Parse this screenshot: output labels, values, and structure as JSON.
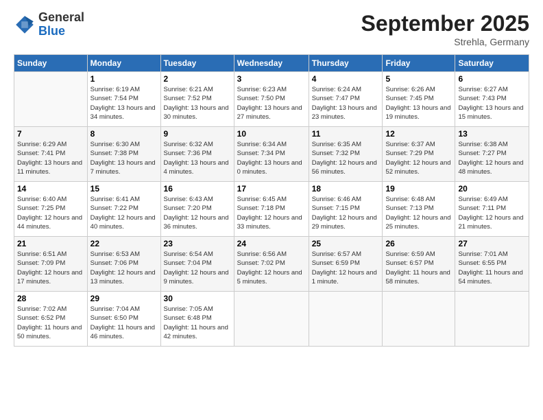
{
  "logo": {
    "general": "General",
    "blue": "Blue"
  },
  "header": {
    "month": "September 2025",
    "location": "Strehla, Germany"
  },
  "days": [
    "Sunday",
    "Monday",
    "Tuesday",
    "Wednesday",
    "Thursday",
    "Friday",
    "Saturday"
  ],
  "weeks": [
    [
      {
        "date": "",
        "sunrise": "",
        "sunset": "",
        "daylight": ""
      },
      {
        "date": "1",
        "sunrise": "Sunrise: 6:19 AM",
        "sunset": "Sunset: 7:54 PM",
        "daylight": "Daylight: 13 hours and 34 minutes."
      },
      {
        "date": "2",
        "sunrise": "Sunrise: 6:21 AM",
        "sunset": "Sunset: 7:52 PM",
        "daylight": "Daylight: 13 hours and 30 minutes."
      },
      {
        "date": "3",
        "sunrise": "Sunrise: 6:23 AM",
        "sunset": "Sunset: 7:50 PM",
        "daylight": "Daylight: 13 hours and 27 minutes."
      },
      {
        "date": "4",
        "sunrise": "Sunrise: 6:24 AM",
        "sunset": "Sunset: 7:47 PM",
        "daylight": "Daylight: 13 hours and 23 minutes."
      },
      {
        "date": "5",
        "sunrise": "Sunrise: 6:26 AM",
        "sunset": "Sunset: 7:45 PM",
        "daylight": "Daylight: 13 hours and 19 minutes."
      },
      {
        "date": "6",
        "sunrise": "Sunrise: 6:27 AM",
        "sunset": "Sunset: 7:43 PM",
        "daylight": "Daylight: 13 hours and 15 minutes."
      }
    ],
    [
      {
        "date": "7",
        "sunrise": "Sunrise: 6:29 AM",
        "sunset": "Sunset: 7:41 PM",
        "daylight": "Daylight: 13 hours and 11 minutes."
      },
      {
        "date": "8",
        "sunrise": "Sunrise: 6:30 AM",
        "sunset": "Sunset: 7:38 PM",
        "daylight": "Daylight: 13 hours and 7 minutes."
      },
      {
        "date": "9",
        "sunrise": "Sunrise: 6:32 AM",
        "sunset": "Sunset: 7:36 PM",
        "daylight": "Daylight: 13 hours and 4 minutes."
      },
      {
        "date": "10",
        "sunrise": "Sunrise: 6:34 AM",
        "sunset": "Sunset: 7:34 PM",
        "daylight": "Daylight: 13 hours and 0 minutes."
      },
      {
        "date": "11",
        "sunrise": "Sunrise: 6:35 AM",
        "sunset": "Sunset: 7:32 PM",
        "daylight": "Daylight: 12 hours and 56 minutes."
      },
      {
        "date": "12",
        "sunrise": "Sunrise: 6:37 AM",
        "sunset": "Sunset: 7:29 PM",
        "daylight": "Daylight: 12 hours and 52 minutes."
      },
      {
        "date": "13",
        "sunrise": "Sunrise: 6:38 AM",
        "sunset": "Sunset: 7:27 PM",
        "daylight": "Daylight: 12 hours and 48 minutes."
      }
    ],
    [
      {
        "date": "14",
        "sunrise": "Sunrise: 6:40 AM",
        "sunset": "Sunset: 7:25 PM",
        "daylight": "Daylight: 12 hours and 44 minutes."
      },
      {
        "date": "15",
        "sunrise": "Sunrise: 6:41 AM",
        "sunset": "Sunset: 7:22 PM",
        "daylight": "Daylight: 12 hours and 40 minutes."
      },
      {
        "date": "16",
        "sunrise": "Sunrise: 6:43 AM",
        "sunset": "Sunset: 7:20 PM",
        "daylight": "Daylight: 12 hours and 36 minutes."
      },
      {
        "date": "17",
        "sunrise": "Sunrise: 6:45 AM",
        "sunset": "Sunset: 7:18 PM",
        "daylight": "Daylight: 12 hours and 33 minutes."
      },
      {
        "date": "18",
        "sunrise": "Sunrise: 6:46 AM",
        "sunset": "Sunset: 7:15 PM",
        "daylight": "Daylight: 12 hours and 29 minutes."
      },
      {
        "date": "19",
        "sunrise": "Sunrise: 6:48 AM",
        "sunset": "Sunset: 7:13 PM",
        "daylight": "Daylight: 12 hours and 25 minutes."
      },
      {
        "date": "20",
        "sunrise": "Sunrise: 6:49 AM",
        "sunset": "Sunset: 7:11 PM",
        "daylight": "Daylight: 12 hours and 21 minutes."
      }
    ],
    [
      {
        "date": "21",
        "sunrise": "Sunrise: 6:51 AM",
        "sunset": "Sunset: 7:09 PM",
        "daylight": "Daylight: 12 hours and 17 minutes."
      },
      {
        "date": "22",
        "sunrise": "Sunrise: 6:53 AM",
        "sunset": "Sunset: 7:06 PM",
        "daylight": "Daylight: 12 hours and 13 minutes."
      },
      {
        "date": "23",
        "sunrise": "Sunrise: 6:54 AM",
        "sunset": "Sunset: 7:04 PM",
        "daylight": "Daylight: 12 hours and 9 minutes."
      },
      {
        "date": "24",
        "sunrise": "Sunrise: 6:56 AM",
        "sunset": "Sunset: 7:02 PM",
        "daylight": "Daylight: 12 hours and 5 minutes."
      },
      {
        "date": "25",
        "sunrise": "Sunrise: 6:57 AM",
        "sunset": "Sunset: 6:59 PM",
        "daylight": "Daylight: 12 hours and 1 minute."
      },
      {
        "date": "26",
        "sunrise": "Sunrise: 6:59 AM",
        "sunset": "Sunset: 6:57 PM",
        "daylight": "Daylight: 11 hours and 58 minutes."
      },
      {
        "date": "27",
        "sunrise": "Sunrise: 7:01 AM",
        "sunset": "Sunset: 6:55 PM",
        "daylight": "Daylight: 11 hours and 54 minutes."
      }
    ],
    [
      {
        "date": "28",
        "sunrise": "Sunrise: 7:02 AM",
        "sunset": "Sunset: 6:52 PM",
        "daylight": "Daylight: 11 hours and 50 minutes."
      },
      {
        "date": "29",
        "sunrise": "Sunrise: 7:04 AM",
        "sunset": "Sunset: 6:50 PM",
        "daylight": "Daylight: 11 hours and 46 minutes."
      },
      {
        "date": "30",
        "sunrise": "Sunrise: 7:05 AM",
        "sunset": "Sunset: 6:48 PM",
        "daylight": "Daylight: 11 hours and 42 minutes."
      },
      {
        "date": "",
        "sunrise": "",
        "sunset": "",
        "daylight": ""
      },
      {
        "date": "",
        "sunrise": "",
        "sunset": "",
        "daylight": ""
      },
      {
        "date": "",
        "sunrise": "",
        "sunset": "",
        "daylight": ""
      },
      {
        "date": "",
        "sunrise": "",
        "sunset": "",
        "daylight": ""
      }
    ]
  ]
}
